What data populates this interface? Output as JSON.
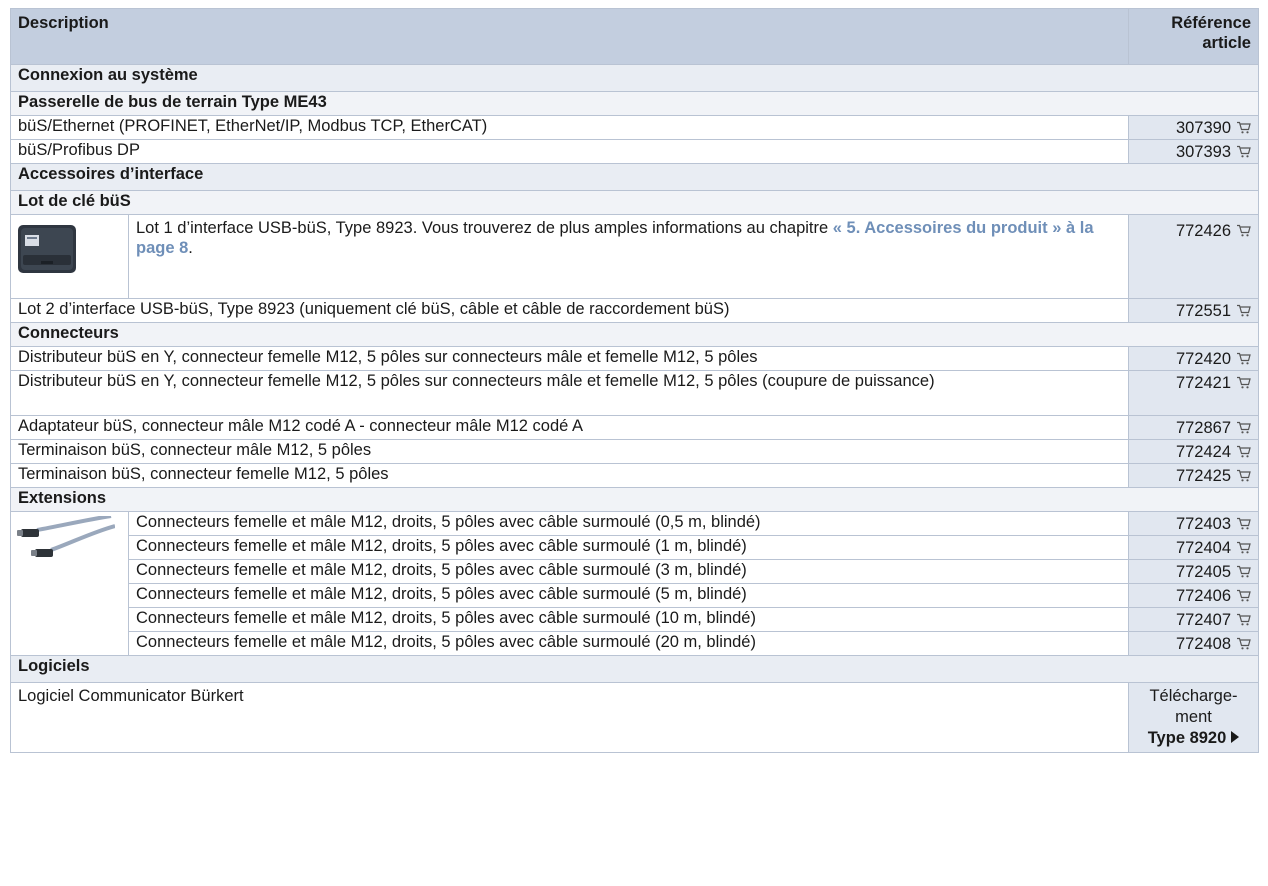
{
  "header": {
    "description": "Description",
    "reference": "Référence article"
  },
  "sections": {
    "system": "Connexion au système",
    "gateway": "Passerelle de bus de terrain Type ME43",
    "interface": "Accessoires d’interface",
    "key_set": "Lot de clé büS",
    "connectors": "Connecteurs",
    "extensions": "Extensions",
    "software": "Logiciels"
  },
  "gateway_rows": [
    {
      "desc": "büS/Ethernet (PROFINET, EtherNet/IP, Modbus TCP, EtherCAT)",
      "ref": "307390"
    },
    {
      "desc": "büS/Profibus DP",
      "ref": "307393"
    }
  ],
  "key_set": {
    "lot1_text": "Lot 1 d’interface USB-büS, Type 8923. Vous trouverez de plus amples informations au chapitre ",
    "lot1_link": "« 5. Accessoires du produit » à la page 8",
    "lot1_tail": ".",
    "lot1_ref": "772426",
    "lot2_text": "Lot 2 d’interface USB-büS, Type 8923 (uniquement clé büS, câble et câble de raccordement büS)",
    "lot2_ref": "772551"
  },
  "connector_rows": [
    {
      "desc": "Distributeur büS en Y, connecteur femelle M12, 5 pôles sur connecteurs mâle et femelle M12, 5 pôles",
      "ref": "772420"
    },
    {
      "desc": "Distributeur büS en Y, connecteur femelle M12, 5 pôles sur connecteurs mâle et femelle M12, 5 pôles (coupure de puissance)",
      "ref": "772421"
    },
    {
      "desc": "Adaptateur büS, connecteur mâle M12 codé A - connecteur mâle M12 codé A",
      "ref": "772867"
    },
    {
      "desc": "Terminaison büS, connecteur mâle M12, 5 pôles",
      "ref": "772424"
    },
    {
      "desc": "Terminaison büS, connecteur femelle M12, 5 pôles",
      "ref": "772425"
    }
  ],
  "extension_rows": [
    {
      "desc": "Connecteurs femelle et mâle M12, droits, 5 pôles avec câble surmoulé (0,5 m, blindé)",
      "ref": "772403"
    },
    {
      "desc": "Connecteurs femelle et mâle M12, droits, 5 pôles avec câble surmoulé (1 m, blindé)",
      "ref": "772404"
    },
    {
      "desc": "Connecteurs femelle et mâle M12, droits, 5 pôles avec câble surmoulé (3 m, blindé)",
      "ref": "772405"
    },
    {
      "desc": "Connecteurs femelle et mâle M12, droits, 5 pôles avec câble surmoulé (5 m, blindé)",
      "ref": "772406"
    },
    {
      "desc": "Connecteurs femelle et mâle M12, droits, 5 pôles avec câble surmoulé (10 m, blindé)",
      "ref": "772407"
    },
    {
      "desc": "Connecteurs femelle et mâle M12, droits, 5 pôles avec câble surmoulé (20 m, blindé)",
      "ref": "772408"
    }
  ],
  "software": {
    "desc": "Logiciel Communicator Bürkert",
    "download_line1": "Télécharge-",
    "download_line2": "ment",
    "download_link": "Type 8920"
  },
  "icons": {
    "cart": "shopping-cart-icon",
    "arrow": "triangle-right-icon"
  },
  "colors": {
    "header_bg": "#c3cedf",
    "section_bg": "#e9edf3",
    "ref_bg": "#e1e7f0",
    "link": "#6f8fb8"
  }
}
